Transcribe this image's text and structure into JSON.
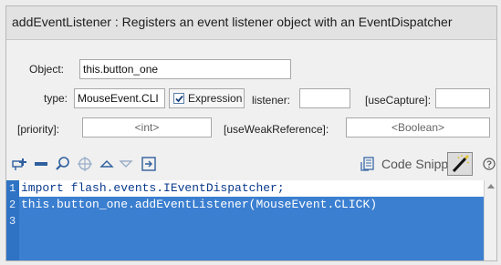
{
  "header": {
    "title": "addEventListener : Registers an event listener object with an EventDispatcher"
  },
  "params": {
    "object_label": "Object:",
    "object_value": "this.button_one",
    "type_label": "type:",
    "type_value": "MouseEvent.CLI",
    "expression_label": "Expression",
    "expression_checked": true,
    "listener_label": "listener:",
    "listener_value": "",
    "usecapture_label": "[useCapture]:",
    "usecapture_value": "",
    "priority_label": "[priority]:",
    "priority_placeholder": "<int>",
    "useweak_label": "[useWeakReference]:",
    "useweak_placeholder": "<Boolean>"
  },
  "toolbar": {
    "icons": [
      "add-statement-icon",
      "delete-icon",
      "find-icon",
      "target-icon",
      "move-up-icon",
      "move-down-icon",
      "insert-icon"
    ],
    "snippets_label": "Code Snippets",
    "wand_icon": "magic-wand-icon",
    "help_icon": "help-icon"
  },
  "editor": {
    "line_numbers": [
      "1",
      "2",
      "3"
    ],
    "lines": [
      "import flash.events.IEventDispatcher;",
      "this.button_one.addEventListener(MouseEvent.CLICK)"
    ]
  },
  "colors": {
    "selection": "#3b7fd0",
    "gutter": "#2f73c4",
    "keyword": "#0a3a8c"
  }
}
